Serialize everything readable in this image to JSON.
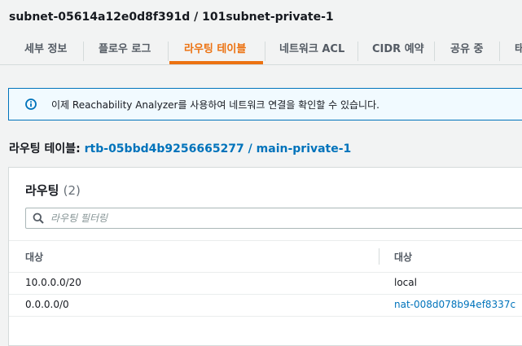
{
  "header": {
    "title": "subnet-05614a12e0d8f391d / 101subnet-private-1"
  },
  "tabs": [
    {
      "label": "세부 정보"
    },
    {
      "label": "플로우 로그"
    },
    {
      "label": "라우팅 테이블",
      "active": true
    },
    {
      "label": "네트워크 ACL"
    },
    {
      "label": "CIDR 예약"
    },
    {
      "label": "공유 중"
    },
    {
      "label": "태"
    }
  ],
  "alert": {
    "icon": "info-icon",
    "text": "이제 Reachability Analyzer를 사용하여 네트워크 연결을 확인할 수 있습니다."
  },
  "route_table": {
    "label": "라우팅 테이블:",
    "link": "rtb-05bbd4b9256665277 / main-private-1"
  },
  "routes": {
    "title": "라우팅",
    "count": "(2)",
    "filter_placeholder": "라우팅 필터링",
    "columns": [
      "대상",
      "대상"
    ],
    "rows": [
      {
        "destination": "10.0.0.0/20",
        "target": "local"
      },
      {
        "destination": "0.0.0.0/0",
        "target": "nat-008d078b94ef8337c"
      }
    ]
  },
  "colors": {
    "accent": "#ec7211",
    "link": "#0073bb",
    "info_bg": "#f1faff"
  }
}
